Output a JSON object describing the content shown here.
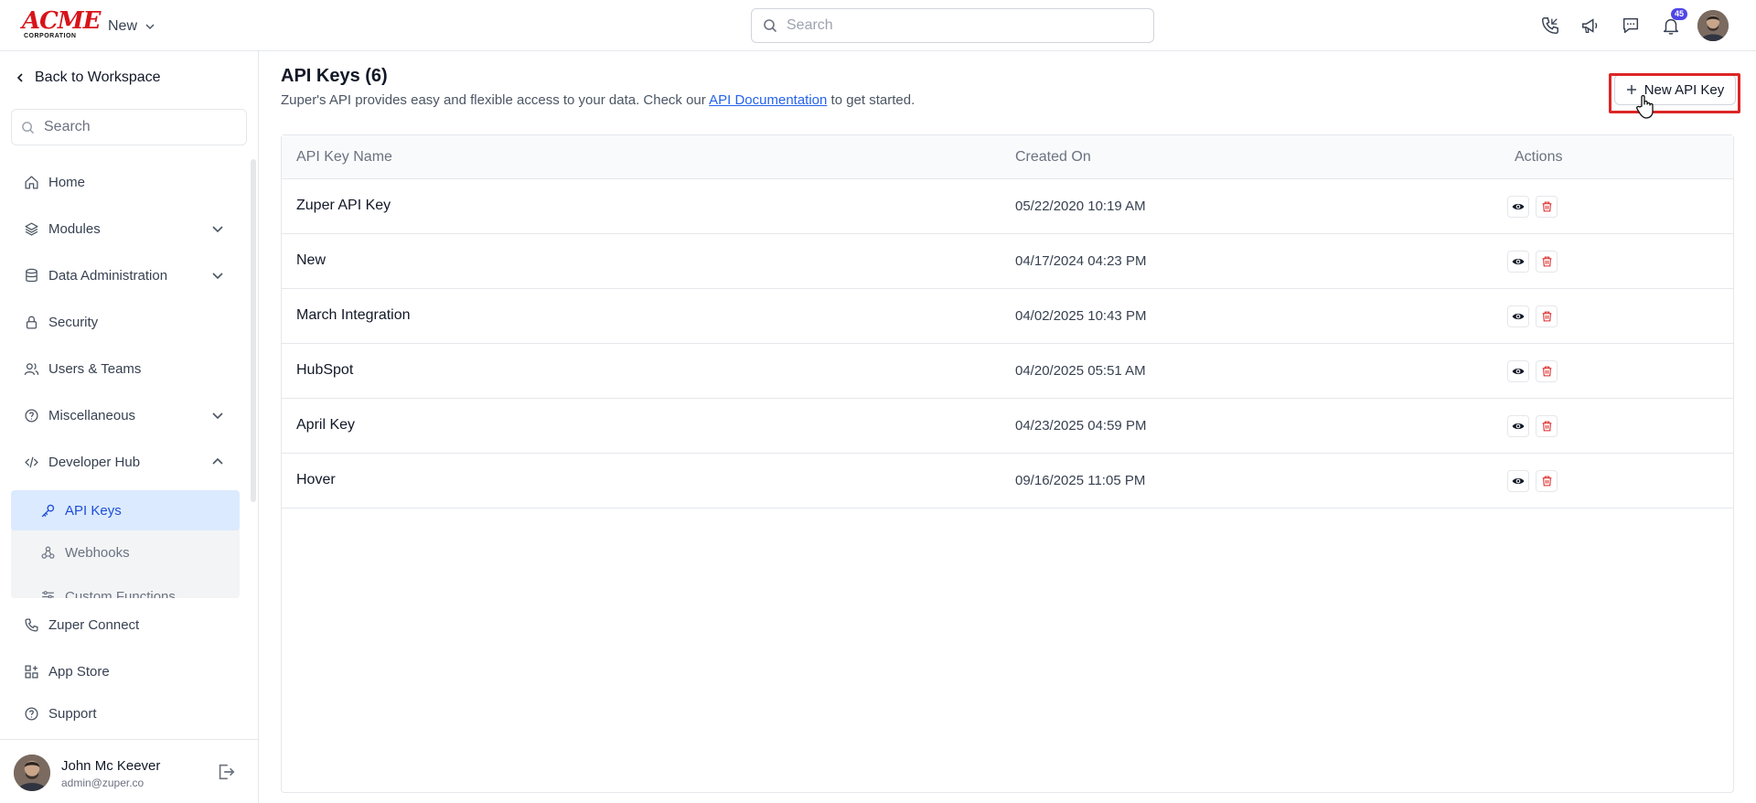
{
  "topbar": {
    "logo_top": "ACME",
    "logo_bottom": "CORPORATION",
    "new_label": "New",
    "search_placeholder": "Search",
    "notification_count": "45"
  },
  "sidebar": {
    "back_label": "Back to Workspace",
    "search_placeholder": "Search",
    "items": [
      {
        "label": "Home"
      },
      {
        "label": "Modules"
      },
      {
        "label": "Data Administration"
      },
      {
        "label": "Security"
      },
      {
        "label": "Users & Teams"
      },
      {
        "label": "Miscellaneous"
      },
      {
        "label": "Developer Hub"
      }
    ],
    "sub_items": [
      {
        "label": "API Keys"
      },
      {
        "label": "Webhooks"
      },
      {
        "label": "Custom Functions"
      }
    ],
    "bottom_items": [
      {
        "label": "Zuper Connect"
      },
      {
        "label": "App Store"
      },
      {
        "label": "Support"
      }
    ],
    "user": {
      "name": "John Mc Keever",
      "email": "admin@zuper.co"
    }
  },
  "main": {
    "title": "API Keys (6)",
    "desc_before": "Zuper's API provides easy and flexible access to your data. Check our ",
    "desc_link": "API Documentation",
    "desc_after": " to get started.",
    "new_button": "New API Key",
    "columns": {
      "name": "API Key Name",
      "created": "Created On",
      "actions": "Actions"
    },
    "rows": [
      {
        "name": "Zuper API Key",
        "created": "05/22/2020 10:19 AM"
      },
      {
        "name": "New",
        "created": "04/17/2024 04:23 PM"
      },
      {
        "name": "March Integration",
        "created": "04/02/2025 10:43 PM"
      },
      {
        "name": "HubSpot",
        "created": "04/20/2025 05:51 AM"
      },
      {
        "name": "April Key",
        "created": "04/23/2025 04:59 PM"
      },
      {
        "name": "Hover",
        "created": "09/16/2025 11:05 PM"
      }
    ]
  },
  "colors": {
    "accent": "#2563eb",
    "danger": "#dc2626",
    "active_bg": "#dbeafe"
  }
}
